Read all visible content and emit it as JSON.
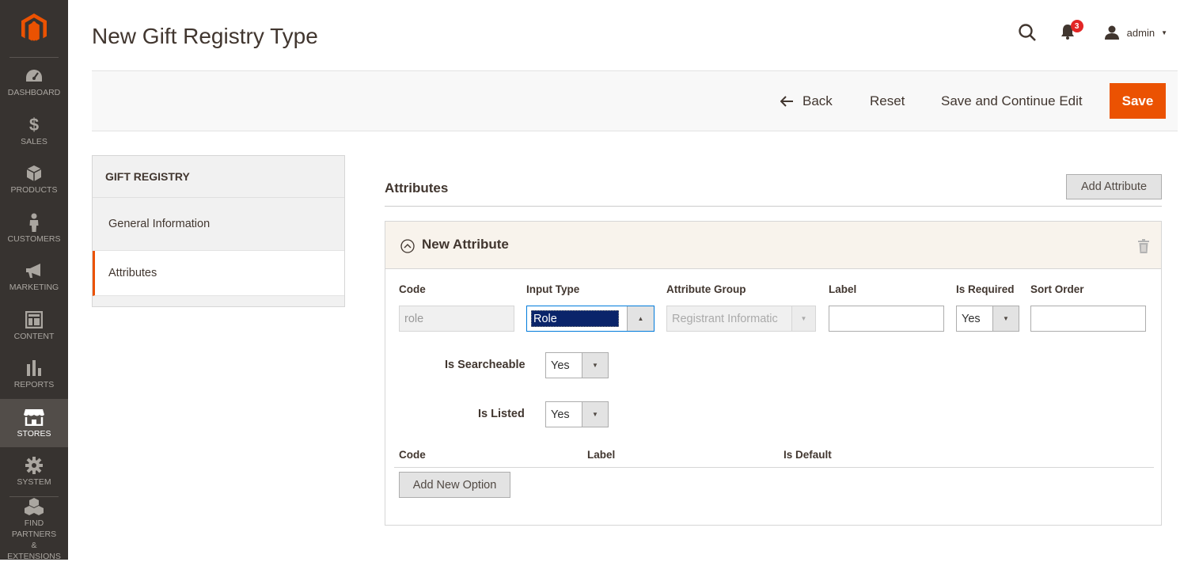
{
  "sidebar": {
    "items": [
      {
        "label": "DASHBOARD",
        "icon": "dashboard-icon"
      },
      {
        "label": "SALES",
        "icon": "dollar-icon"
      },
      {
        "label": "PRODUCTS",
        "icon": "box-icon"
      },
      {
        "label": "CUSTOMERS",
        "icon": "person-icon"
      },
      {
        "label": "MARKETING",
        "icon": "megaphone-icon"
      },
      {
        "label": "CONTENT",
        "icon": "layout-icon"
      },
      {
        "label": "REPORTS",
        "icon": "bar-chart-icon"
      },
      {
        "label": "STORES",
        "icon": "store-icon",
        "active": true
      },
      {
        "label": "SYSTEM",
        "icon": "gear-icon"
      }
    ],
    "partners_line1": "FIND PARTNERS",
    "partners_line2": "& EXTENSIONS"
  },
  "header": {
    "title": "New Gift Registry Type",
    "notifications_count": "3",
    "user": "admin"
  },
  "actions": {
    "back": "Back",
    "reset": "Reset",
    "save_continue": "Save and Continue Edit",
    "save": "Save"
  },
  "tabs": {
    "title": "GIFT REGISTRY",
    "items": [
      "General Information",
      "Attributes"
    ]
  },
  "attributes": {
    "section_title": "Attributes",
    "add_attribute": "Add Attribute",
    "card_title": "New Attribute",
    "labels": {
      "code": "Code",
      "input_type": "Input Type",
      "attribute_group": "Attribute Group",
      "label": "Label",
      "is_required": "Is Required",
      "sort_order": "Sort Order",
      "is_searchable": "Is Searcheable",
      "is_listed": "Is Listed"
    },
    "values": {
      "code": "role",
      "input_type": "Role",
      "attribute_group": "Registrant Informatic",
      "label": "",
      "is_required": "Yes",
      "sort_order": "",
      "is_searchable": "Yes",
      "is_listed": "Yes"
    },
    "options_table": {
      "headers": [
        "Code",
        "Label",
        "Is Default"
      ],
      "add_new_option": "Add New Option"
    }
  },
  "colors": {
    "sidebar_bg": "#373330",
    "accent": "#eb5202",
    "card_header_bg": "#f8f3ec"
  }
}
